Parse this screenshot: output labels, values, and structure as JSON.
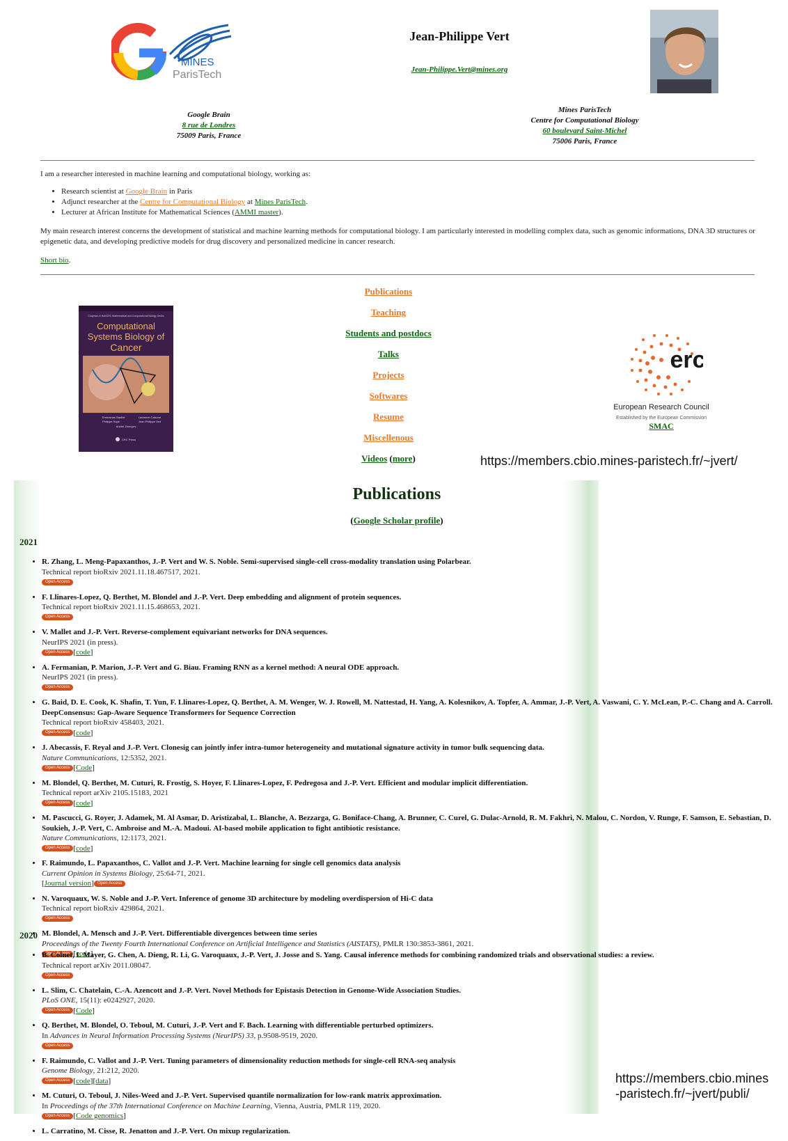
{
  "home": {
    "name": "Jean-Philippe Vert",
    "email": "Jean-Philippe.Vert@mines.org",
    "logo_text": [
      "MINES",
      "ParisTech"
    ],
    "left_address": {
      "org": "Google Brain",
      "street": "8 rue de Londres",
      "city": "75009 Paris, France"
    },
    "right_address": {
      "org": "Mines ParisTech",
      "dept": "Centre for Computational Biology",
      "street": "60 boulevard Saint-Michel",
      "city": "75006 Paris, France"
    },
    "intro": "I am a researcher interested in machine learning and computational biology, working as:",
    "roles": [
      {
        "a": "Research scientist at ",
        "link": "Google Brain",
        "b": " in Paris",
        "link2": "",
        "c": ""
      },
      {
        "a": "Adjunct researcher at the ",
        "link": "Centre for Computational Biology",
        "b": " at ",
        "link2": "Mines ParisTech",
        "c": "."
      },
      {
        "a": "Lecturer at African Institute for Mathematical Sciences (",
        "link": "",
        "b": "",
        "link2": "AMMI master",
        "c": ")."
      }
    ],
    "research": "My main research interest concerns the development of statistical and machine learning methods for computational biology. I am particularly interested in modelling complex data, such as genomic informations, DNA 3D structures or epigenetic data, and developing predictive models for drug discovery and personalized medicine in cancer research.",
    "short_bio": "Short bio",
    "short_bio_period": ".",
    "book": {
      "series": "Chapman & Hall/CRC Mathematical and Computational Biology Series",
      "title": [
        "Computational",
        "Systems Biology of",
        "Cancer"
      ],
      "authors": [
        "Emmanuel Barillot",
        "Laurence Calzone",
        "Philippe Hupé",
        "Jean-Philippe Vert",
        "Andrei Zinovyev"
      ],
      "publisher": "CRC Press"
    },
    "menu": [
      {
        "label": "Publications",
        "color": "orange"
      },
      {
        "label": "Teaching",
        "color": "orange"
      },
      {
        "label": "Students and postdocs",
        "color": "green"
      },
      {
        "label": "Talks",
        "color": "green"
      },
      {
        "label": "Projects",
        "color": "orange"
      },
      {
        "label": "Softwares",
        "color": "orange"
      },
      {
        "label": "Resume",
        "color": "orange"
      },
      {
        "label": "Miscellenous",
        "color": "orange"
      }
    ],
    "videos": "Videos",
    "more": "more",
    "erc": {
      "logo": "erc",
      "title": "European Research Council",
      "subtitle": "Established by the European Commission",
      "link": "SMAC"
    },
    "url": "https://members.cbio.mines-paristech.fr/~jvert/"
  },
  "publications": {
    "title": "Publications",
    "scholar": "Google Scholar profile",
    "open_access": "Open Access",
    "years": [
      {
        "year": "2021",
        "items": [
          {
            "authors": "R. Zhang, L. Meng-Papaxanthos, J.-P. Vert and W. S. Noble.",
            "title": "Semi-supervised single-cell cross-modality translation using Polarbear.",
            "venue": "Technical report bioRxiv 2021.11.18.467517, 2021.",
            "italic": false,
            "links": []
          },
          {
            "authors": "F. Llinares-Lopez, Q. Berthet, M. Blondel and J.-P. Vert.",
            "title": "Deep embedding and alignment of protein sequences.",
            "venue": "Technical report bioRxiv 2021.11.15.468653, 2021.",
            "italic": false,
            "links": []
          },
          {
            "authors": "V. Mallet and J.-P. Vert.",
            "title": "Reverse-complement equivariant networks for DNA sequences.",
            "venue": "NeurIPS 2021 (in press).",
            "italic": false,
            "links": [
              "code"
            ]
          },
          {
            "authors": "A. Fermanian, P. Marion, J.-P. Vert and G. Biau.",
            "title": "Framing RNN as a kernel method: A neural ODE approach.",
            "venue": "NeurIPS 2021 (in press).",
            "italic": false,
            "links": []
          },
          {
            "authors": "G. Baid, D. E. Cook, K. Shafin, T. Yun, F. Llinares-Lopez, Q. Berthet, A. M. Wenger, W. J. Rowell, M. Nattestad, H. Yang, A. Kolesnikov, A. Topfer, A. Ammar, J.-P. Vert, A. Vaswani, C. Y. McLean, P.-C. Chang and A. Carroll.",
            "title": "DeepConsensus: Gap-Aware Sequence Transformers for Sequence Correction",
            "venue": "Technical report bioRxiv 458403, 2021.",
            "italic": false,
            "links": [
              "code"
            ]
          },
          {
            "authors": "J. Abecassis, F. Reyal and J.-P. Vert.",
            "title": "Clonesig can jointly infer intra-tumor heterogeneity and mutational signature activity in tumor bulk sequencing data.",
            "venue": "Nature Communications",
            "venue_rest": ", 12:5352, 2021.",
            "italic": true,
            "links": [
              "Code"
            ]
          },
          {
            "authors": "M. Blondel, Q. Berthet, M. Cuturi, R. Frostig, S. Hoyer, F. Llinares-Lopez, F. Pedregosa and J.-P. Vert.",
            "title": "Efficient and modular implicit differentiation.",
            "venue": "Technical report arXiv 2105.15183, 2021",
            "italic": false,
            "links": [
              "code"
            ]
          },
          {
            "authors": "M. Pascucci, G. Royer, J. Adamek, M. Al Asmar, D. Aristizabal, L. Blanche, A. Bezzarga, G. Boniface-Chang, A. Brunner, C. Curel, G. Dulac-Arnold, R. M. Fakhri, N. Malou, C. Nordon, V. Runge, F. Samson, E. Sebastian, D. Soukieh, J.-P. Vert, C. Ambroise and M.-A. Madoui.",
            "title": "AI-based mobile application to fight antibiotic resistance.",
            "venue": "Nature Communications",
            "venue_rest": ", 12:1173, 2021.",
            "italic": true,
            "links": [
              "code"
            ]
          },
          {
            "authors": "F. Raimundo, L. Papaxanthos, C. Vallot and J.-P. Vert.",
            "title": "Machine learning for single cell genomics data analysis",
            "venue": "Current Opinion in Systems Biology",
            "venue_rest": ", 25:64-71, 2021.",
            "italic": true,
            "links": [],
            "pre_link": "Journal version"
          },
          {
            "authors": "N. Varoquaux, W. S. Noble and J.-P. Vert.",
            "title": "Inference of genome 3D architecture by modeling overdispersion of Hi-C data",
            "venue": "Technical report bioRxiv 429864, 2021.",
            "italic": false,
            "links": []
          },
          {
            "authors": "M. Blondel, A. Mensch and J.-P. Vert.",
            "title": "Differentiable divergences between time series",
            "venue": "Proceedings of the Twenty Fourth International Conference on Artificial Intelligence and Statistics (AISTATS)",
            "venue_rest": ", PMLR 130:3853-3861, 2021.",
            "italic": true,
            "links": [
              "code"
            ]
          }
        ]
      },
      {
        "year": "2020",
        "items": [
          {
            "authors": "B. Colnet, I. Mayer, G. Chen, A. Dieng, R. Li, G. Varoquaux, J.-P. Vert, J. Josse and S. Yang.",
            "title": "Causal inference methods for combining randomized trials and observational studies: a review.",
            "venue": "Technical report arXiv 2011.08047.",
            "italic": false,
            "links": []
          },
          {
            "authors": "L. Slim, C. Chatelain, C.-A. Azencott and J.-P. Vert.",
            "title": "Novel Methods for Epistasis Detection in Genome-Wide Association Studies.",
            "venue": "PLoS ONE",
            "venue_rest": ", 15(11): e0242927, 2020.",
            "italic": true,
            "links": [
              "Code"
            ]
          },
          {
            "authors": "Q. Berthet, M. Blondel, O. Teboul, M. Cuturi, J.-P. Vert and F. Bach.",
            "title": "Learning with differentiable perturbed optimizers.",
            "venue_pre": "In ",
            "venue": "Advances in Neural Information Processing Systems (NeurIPS) 33",
            "venue_rest": ", p.9508-9519, 2020.",
            "italic": true,
            "links": []
          },
          {
            "authors": "F. Raimundo, C. Vallot and J.-P. Vert.",
            "title": "Tuning parameters of dimensionality reduction methods for single-cell RNA-seq analysis",
            "venue": "Genome Biology",
            "venue_rest": ", 21:212, 2020.",
            "italic": true,
            "links": [
              "code",
              "data"
            ]
          },
          {
            "authors": "M. Cuturi, O. Teboul, J. Niles-Weed and J.-P. Vert.",
            "title": "Supervised quantile normalization for low-rank matrix approximation.",
            "venue_pre": "In ",
            "venue": "Proceedings of the 37th International Conference on Machine Learning",
            "venue_rest": ", Vienna, Austria, PMLR 119, 2020.",
            "italic": true,
            "links": [
              "Code genomics"
            ]
          },
          {
            "authors": "L. Carratino, M. Cisse, R. Jenatton and J.-P. Vert.",
            "title": "On mixup regularization.",
            "venue": "",
            "italic": false,
            "links": [],
            "no_oa": true
          }
        ]
      }
    ],
    "url": [
      "https://members.cbio.mines",
      "-paristech.fr/~jvert/publi/"
    ]
  }
}
